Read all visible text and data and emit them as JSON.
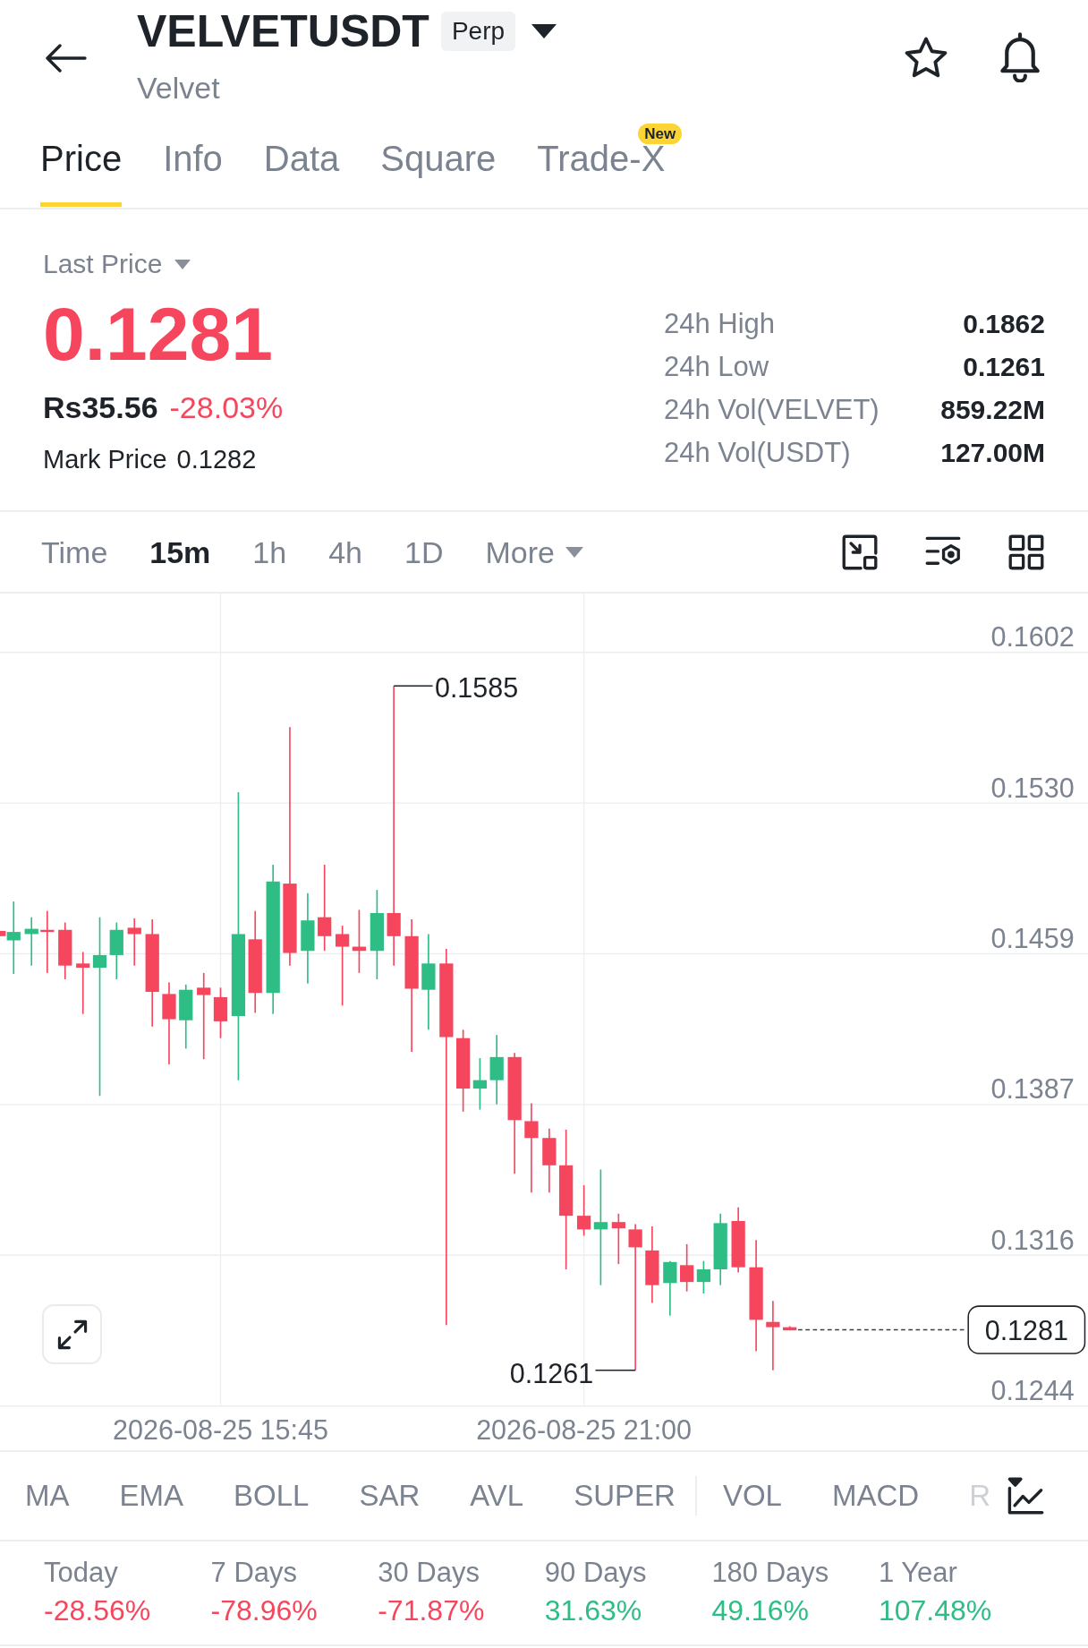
{
  "header": {
    "title": "VELVETUSDT",
    "contract_tag": "Perp",
    "subtitle": "Velvet"
  },
  "tabs": [
    {
      "label": "Price",
      "selected": true
    },
    {
      "label": "Info",
      "selected": false
    },
    {
      "label": "Data",
      "selected": false
    },
    {
      "label": "Square",
      "selected": false
    },
    {
      "label": "Trade-X",
      "selected": false,
      "badge": "New"
    }
  ],
  "price_panel": {
    "price_type": "Last Price",
    "last_price": "0.1281",
    "fiat_price": "Rs35.56",
    "change": "-28.03%",
    "mark_price_label": "Mark Price",
    "mark_price": "0.1282",
    "stats": [
      {
        "label": "24h High",
        "value": "0.1862"
      },
      {
        "label": "24h Low",
        "value": "0.1261"
      },
      {
        "label": "24h Vol(VELVET)",
        "value": "859.22M"
      },
      {
        "label": "24h Vol(USDT)",
        "value": "127.00M"
      }
    ]
  },
  "timeframes": [
    {
      "label": "Time",
      "selected": false,
      "kind": "option"
    },
    {
      "label": "15m",
      "selected": true,
      "kind": "option"
    },
    {
      "label": "1h",
      "selected": false,
      "kind": "option"
    },
    {
      "label": "4h",
      "selected": false,
      "kind": "option"
    },
    {
      "label": "1D",
      "selected": false,
      "kind": "option"
    },
    {
      "label": "More",
      "selected": false,
      "kind": "dropdown"
    }
  ],
  "chart": {
    "y_axis_labels": [
      "0.1602",
      "0.1530",
      "0.1459",
      "0.1387",
      "0.1316",
      "0.1244"
    ],
    "x_axis_labels": [
      "2026-08-25 15:45",
      "2026-08-25 21:00"
    ],
    "high_label": "0.1585",
    "low_label": "0.1261",
    "last_price_tag": "0.1281"
  },
  "indicators": {
    "main": [
      "MA",
      "EMA",
      "BOLL",
      "SAR",
      "AVL",
      "SUPER"
    ],
    "sub": [
      "VOL",
      "MACD",
      "R"
    ]
  },
  "performance": [
    {
      "period": "Today",
      "change": "-28.56%",
      "color": "#f6465d"
    },
    {
      "period": "7 Days",
      "change": "-78.96%",
      "color": "#f6465d"
    },
    {
      "period": "30 Days",
      "change": "-71.87%",
      "color": "#f6465d"
    },
    {
      "period": "90 Days",
      "change": "31.63%",
      "color": "#2ebd85"
    },
    {
      "period": "180 Days",
      "change": "49.16%",
      "color": "#2ebd85"
    },
    {
      "period": "1 Year",
      "change": "107.48%",
      "color": "#2ebd85"
    }
  ]
}
